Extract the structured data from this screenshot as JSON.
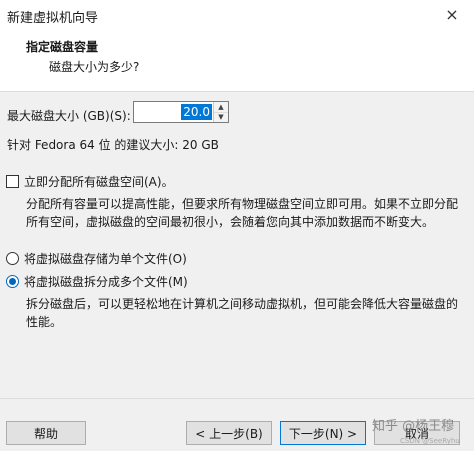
{
  "window": {
    "title": "新建虚拟机向导",
    "close_icon": "×"
  },
  "header": {
    "title": "指定磁盘容量",
    "subtitle": "磁盘大小为多少?"
  },
  "disk": {
    "max_size_label": "最大磁盘大小 (GB)(S):",
    "max_size_value": "20.0",
    "recommendation": "针对 Fedora 64 位 的建议大小: 20 GB"
  },
  "allocate": {
    "label": "立即分配所有磁盘空间(A)。",
    "checked": false,
    "description": "分配所有容量可以提高性能，但要求所有物理磁盘空间立即可用。如果不立即分配所有空间，虚拟磁盘的空间最初很小，会随着您向其中添加数据而不断变大。"
  },
  "storage": {
    "single": {
      "label": "将虚拟磁盘存储为单个文件(O)",
      "selected": false
    },
    "multiple": {
      "label": "将虚拟磁盘拆分成多个文件(M)",
      "selected": true,
      "description": "拆分磁盘后，可以更轻松地在计算机之间移动虚拟机，但可能会降低大容量磁盘的性能。"
    }
  },
  "footer": {
    "help_label": "帮助",
    "back_label": "< 上一步(B)",
    "next_label": "下一步(N) >",
    "cancel_label": "取消"
  },
  "watermark": {
    "text": "知乎 @杨王穆",
    "subtext": "CSDN @SeeRyhu"
  },
  "colors": {
    "accent": "#0078d7",
    "selection": "#0067c0",
    "panel": "#f0f0f0"
  }
}
